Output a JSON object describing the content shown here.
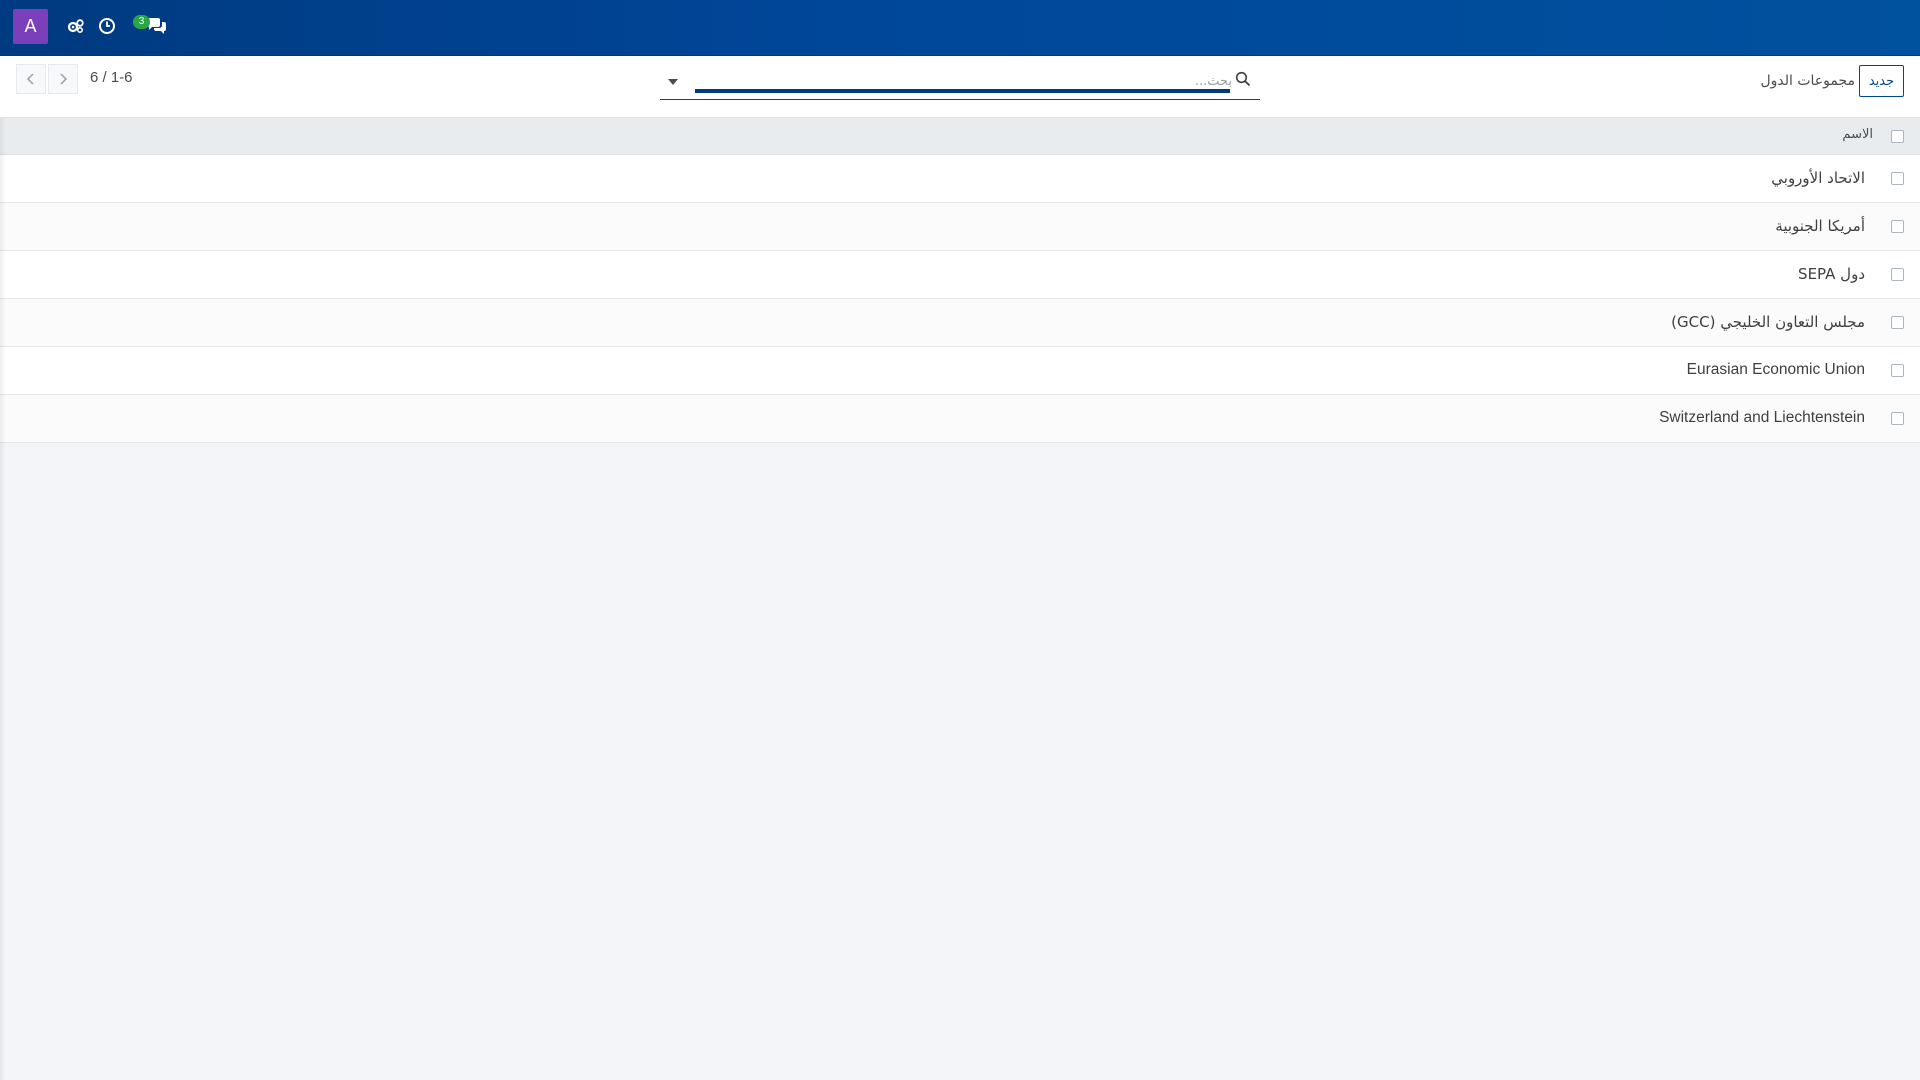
{
  "navbar": {
    "avatar_letter": "A",
    "avatar_color": "#7b3fba",
    "icons": [
      "settings-gears-icon",
      "activity-clock-icon",
      "messaging-chat-icon"
    ],
    "chat_badge_count": "3",
    "accent_color": "#00479a"
  },
  "control_panel": {
    "new_button_label": "جديد",
    "breadcrumb": "مجموعات الدول",
    "search_placeholder": "بحث...",
    "pager_value": "6 / 1-6"
  },
  "list": {
    "header_label": "الاسم",
    "rows": [
      {
        "name": "الاتحاد الأوروبي"
      },
      {
        "name": "أمريكا الجنوبية"
      },
      {
        "name": "دول SEPA"
      },
      {
        "name": "مجلس التعاون الخليجي (GCC)"
      },
      {
        "name": "Eurasian Economic Union"
      },
      {
        "name": "Switzerland and Liechtenstein"
      }
    ]
  }
}
